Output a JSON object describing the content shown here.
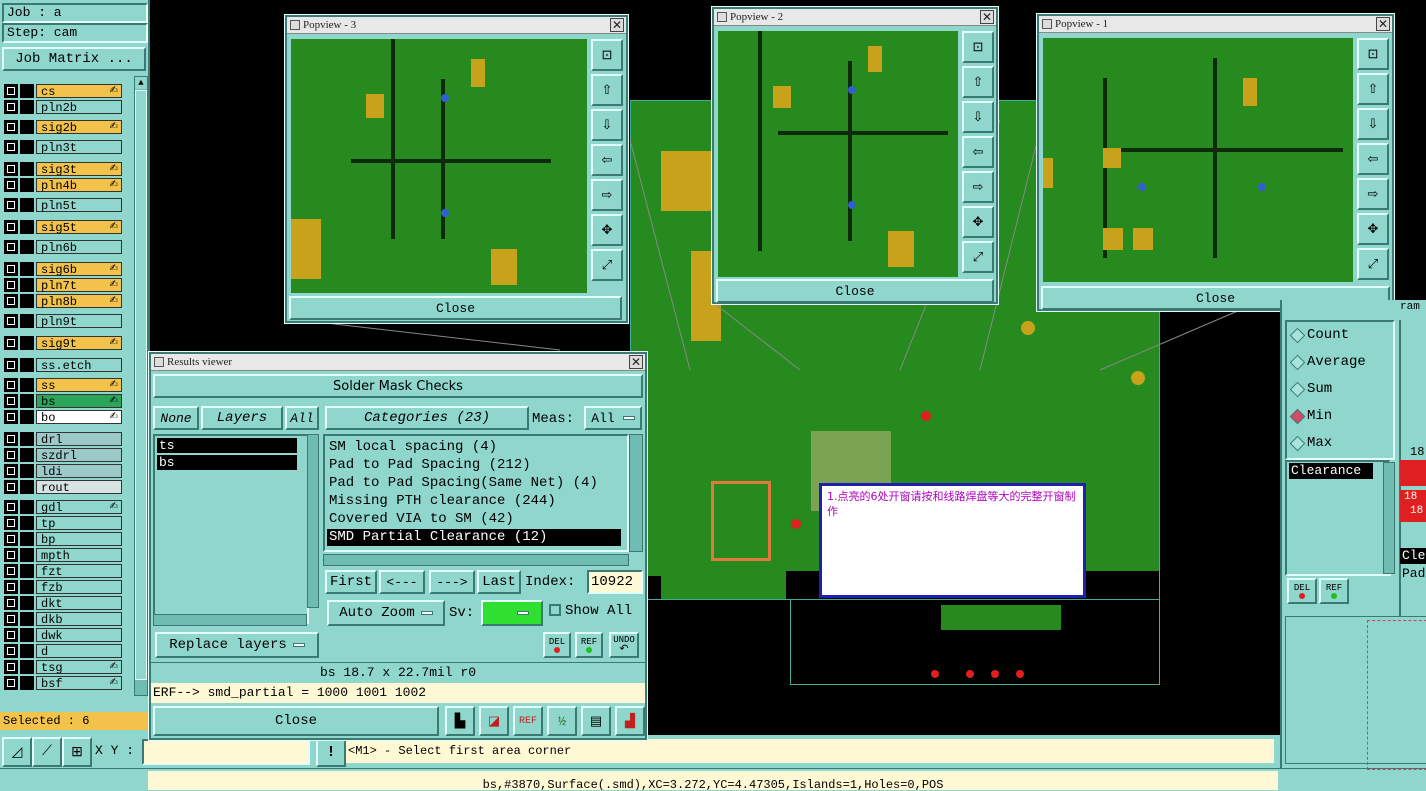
{
  "left_panel": {
    "job_label": "Job : a",
    "step_label": "Step: cam",
    "job_matrix_button": "Job Matrix ...",
    "selected_label": "Selected : 6",
    "layers": [
      {
        "name": "cs",
        "color": "#f2c24a",
        "icon": "✍"
      },
      {
        "name": "pln2b",
        "color": "#8fd6cc",
        "icon": ""
      },
      {
        "name": "sig2b",
        "color": "#f2c24a",
        "icon": "✍"
      },
      {
        "name": "pln3t",
        "color": "#8fd6cc",
        "icon": ""
      },
      {
        "name": "sig3t",
        "color": "#f2c24a",
        "icon": "✍"
      },
      {
        "name": "pln4b",
        "color": "#f2c24a",
        "icon": "✍"
      },
      {
        "name": "pln5t",
        "color": "#8fd6cc",
        "icon": ""
      },
      {
        "name": "sig5t",
        "color": "#f2c24a",
        "icon": "✍"
      },
      {
        "name": "pln6b",
        "color": "#8fd6cc",
        "icon": ""
      },
      {
        "name": "sig6b",
        "color": "#f2c24a",
        "icon": "✍"
      },
      {
        "name": "pln7t",
        "color": "#f2c24a",
        "icon": "✍"
      },
      {
        "name": "pln8b",
        "color": "#f2c24a",
        "icon": "✍"
      },
      {
        "name": "pln9t",
        "color": "#8fd6cc",
        "icon": ""
      },
      {
        "name": "sig9t",
        "color": "#f2c24a",
        "icon": "✍"
      },
      {
        "name": "ss.etch",
        "color": "#8fd6cc",
        "icon": ""
      },
      {
        "name": "ss",
        "color": "#f2c24a",
        "icon": "✍"
      },
      {
        "name": "bs",
        "color": "#2aa55a",
        "icon": "✍"
      },
      {
        "name": "bo",
        "color": "#ffffff",
        "icon": "✍"
      },
      {
        "name": "drl",
        "color": "#9cc8c8",
        "icon": ""
      },
      {
        "name": "szdrl",
        "color": "#9cc8c8",
        "icon": ""
      },
      {
        "name": "ldi",
        "color": "#9cc8c8",
        "icon": ""
      },
      {
        "name": "rout",
        "color": "#d8e4e4",
        "icon": ""
      },
      {
        "name": "gdl",
        "color": "#8fd6cc",
        "icon": "✍"
      },
      {
        "name": "tp",
        "color": "#8fd6cc",
        "icon": ""
      },
      {
        "name": "bp",
        "color": "#8fd6cc",
        "icon": ""
      },
      {
        "name": "mpth",
        "color": "#8fd6cc",
        "icon": ""
      },
      {
        "name": "fzt",
        "color": "#8fd6cc",
        "icon": ""
      },
      {
        "name": "fzb",
        "color": "#8fd6cc",
        "icon": ""
      },
      {
        "name": "dkt",
        "color": "#8fd6cc",
        "icon": ""
      },
      {
        "name": "dkb",
        "color": "#8fd6cc",
        "icon": ""
      },
      {
        "name": "dwk",
        "color": "#8fd6cc",
        "icon": ""
      },
      {
        "name": "d",
        "color": "#8fd6cc",
        "icon": ""
      },
      {
        "name": "tsg",
        "color": "#8fd6cc",
        "icon": "✍"
      },
      {
        "name": "bsf",
        "color": "#8fd6cc",
        "icon": "✍"
      }
    ]
  },
  "popviews": [
    {
      "title": "Popview - 3",
      "close": "Close"
    },
    {
      "title": "Popview - 2",
      "close": "Close"
    },
    {
      "title": "Popview - 1",
      "close": "Close"
    }
  ],
  "results_viewer": {
    "title": "Results viewer",
    "header": "Solder Mask Checks",
    "none_btn": "None",
    "layers_btn": "Layers",
    "all_btn": "All",
    "layer_list": [
      "ts",
      "bs"
    ],
    "categories_label": "Categories (23)",
    "meas_label": "Meas:",
    "meas_value": "All",
    "categories": [
      "SM local spacing (4)",
      "Pad to Pad Spacing (212)",
      "Pad to Pad Spacing(Same Net) (4)",
      "Missing PTH clearance (244)",
      "Covered VIA to SM (42)",
      "SMD Partial Clearance (12)"
    ],
    "first_btn": "First",
    "prev_btn": "<---",
    "next_btn": "--->",
    "last_btn": "Last",
    "index_label": "Index:",
    "index_value": "10922",
    "auto_zoom": "Auto Zoom",
    "sv_label": "Sv:",
    "show_all": "Show All",
    "replace_layers": "Replace layers",
    "del": "DEL",
    "ref": "REF",
    "undo": "UNDO",
    "info_line": "bs 18.7 x 22.7mil  r0",
    "erf_line": "ERF--> smd_partial = 1000 1001 1002",
    "close": "Close"
  },
  "note": {
    "text": "1.点亮的6处开窗请按和线路焊盘等大的完整开窗制作"
  },
  "right_panel": {
    "title_frag": "ram",
    "options": [
      "Count",
      "Average",
      "Sum",
      "Min",
      "Max"
    ],
    "selected": "Min",
    "list_item": "Clearance",
    "value_18": "18",
    "red_top": "18",
    "red_bot": "18",
    "frag1": "Cle",
    "frag2": "Pad",
    "del": "DEL",
    "ref": "REF"
  },
  "bottom": {
    "xy_label": "X Y :",
    "prompt": "<M1> - Select first area corner",
    "status": "bs,#3870,Surface(.smd),XC=3.272,YC=4.47305,Islands=1,Holes=0,POS"
  },
  "colors": {
    "panel": "#8fd6cc",
    "board": "#268a1f",
    "pad": "#c8a21a",
    "note_border": "#2020b0",
    "note_text": "#b000c0"
  }
}
